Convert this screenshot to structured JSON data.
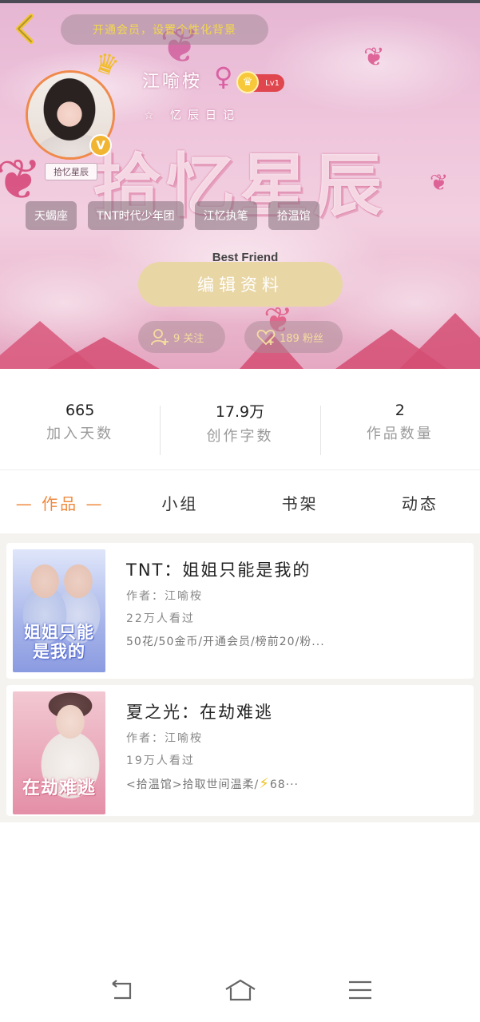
{
  "header": {
    "vip_banner": "开通会员，设置个性化背景",
    "banner_title": "拾忆星辰",
    "banner_subtitle": "Best Friend"
  },
  "profile": {
    "avatar_tag": "拾忆星辰",
    "username": "江喻桉",
    "level": "Lv1",
    "signature": "忆辰日记",
    "verified_mark": "V",
    "tags": [
      "天蝎座",
      "TNT时代少年团",
      "江忆执笔",
      "拾温馆"
    ],
    "edit_button": "编辑资料",
    "following": "9 关注",
    "fans": "189 粉丝"
  },
  "stats": [
    {
      "value": "665",
      "label": "加入天数"
    },
    {
      "value": "17.9万",
      "label": "创作字数"
    },
    {
      "value": "2",
      "label": "作品数量"
    }
  ],
  "tabs": [
    {
      "label": "— 作品 —",
      "active": true
    },
    {
      "label": "小组",
      "active": false
    },
    {
      "label": "书架",
      "active": false
    },
    {
      "label": "动态",
      "active": false
    }
  ],
  "works": [
    {
      "title": "TNT：姐姐只能是我的",
      "author": "作者：江喻桉",
      "views": "22万人看过",
      "tags": "50花/50金币/开通会员/榜前20/粉...",
      "cover_text_line1": "姐姐只能",
      "cover_text_line2": "是我的"
    },
    {
      "title": "夏之光：在劫难逃",
      "author": "作者：江喻桉",
      "views": "19万人看过",
      "tags_prefix": "<拾温馆>拾取世间温柔/",
      "tags_suffix": "68···",
      "cover_text_line1": "在劫难逃"
    }
  ],
  "colors": {
    "accent": "#ef8a3f",
    "edit_button_bg": "#e9d6a5",
    "avatar_border": "#f08a4b",
    "level_badge": "#e0464e",
    "vip_text": "#f3d84a"
  },
  "icons": {
    "back": "chevron-left-icon",
    "gender": "female-icon",
    "crown": "crown-icon",
    "following": "add-user-icon",
    "fans": "heart-icon",
    "nav_back": "return-icon",
    "nav_home": "home-icon",
    "nav_menu": "menu-icon"
  }
}
